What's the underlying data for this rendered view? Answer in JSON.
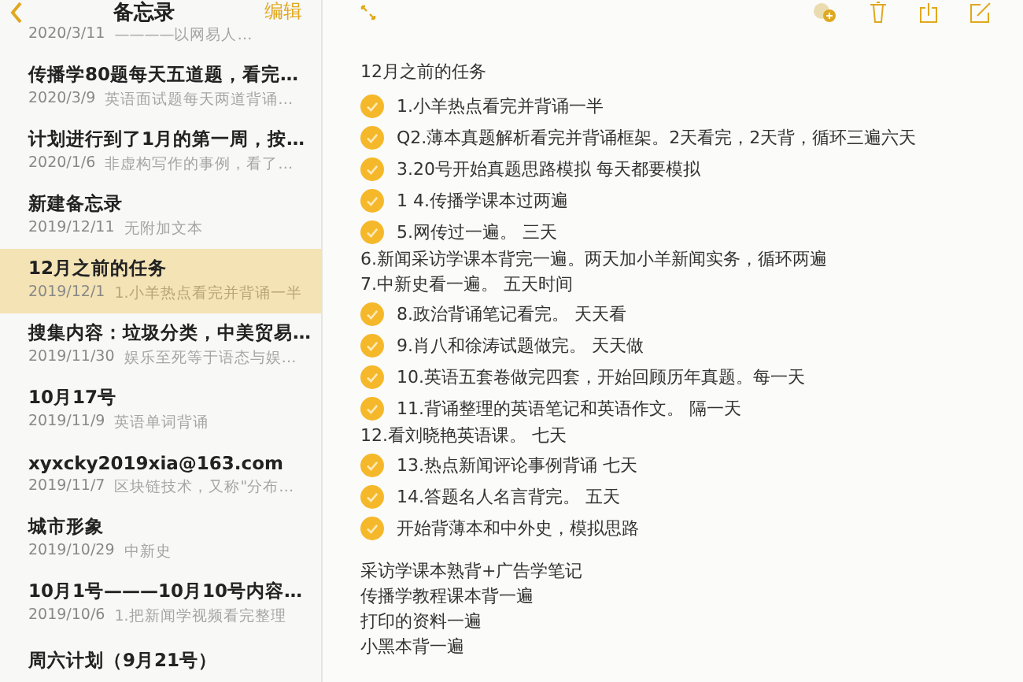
{
  "sidebar": {
    "title": "备忘录",
    "edit": "编辑",
    "notes": [
      {
        "date": "2020/3/11",
        "preview": "————以网易人…",
        "selected": false
      },
      {
        "title": "传播学80题每天五道题，看完…",
        "date": "2020/3/9",
        "preview": "英语面试题每天两道背诵…",
        "selected": false
      },
      {
        "title": "计划进行到了1月的第一周，按…",
        "date": "2020/1/6",
        "preview": "非虚构写作的事例，看了…",
        "selected": false
      },
      {
        "title": "新建备忘录",
        "date": "2019/12/11",
        "preview": "无附加文本",
        "selected": false
      },
      {
        "title": "12月之前的任务",
        "date": "2019/12/1",
        "preview": "1.小羊热点看完并背诵一半",
        "selected": true
      },
      {
        "title": "搜集内容：垃圾分类，中美贸易…",
        "date": "2019/11/30",
        "preview": "娱乐至死等于语态与娱…",
        "selected": false
      },
      {
        "title": "10月17号",
        "date": "2019/11/9",
        "preview": "英语单词背诵",
        "selected": false
      },
      {
        "title": "xyxcky2019xia@163.com",
        "date": "2019/11/7",
        "preview": "区块链技术，又称\"分布…",
        "selected": false
      },
      {
        "title": "城市形象",
        "date": "2019/10/29",
        "preview": "中新史",
        "selected": false
      },
      {
        "title": "10月1号———10月10号内容…",
        "date": "2019/10/6",
        "preview": "1.把新闻学视频看完整理",
        "selected": false
      },
      {
        "title": "周六计划（9月21号）",
        "selected": false
      }
    ]
  },
  "note": {
    "title": "12月之前的任务",
    "lines": [
      {
        "kind": "check",
        "text": "1.小羊热点看完并背诵一半",
        "checked": true
      },
      {
        "kind": "check",
        "text": "Q2.薄本真题解析看完并背诵框架。2天看完，2天背，循环三遍六天",
        "checked": true
      },
      {
        "kind": "check",
        "text": "3.20号开始真题思路模拟  每天都要模拟",
        "checked": true
      },
      {
        "kind": "check",
        "text": "1    4.传播学课本过两遍",
        "checked": true
      },
      {
        "kind": "check",
        "text": "5.网传过一遍。   三天",
        "checked": true
      },
      {
        "kind": "text",
        "text": "6.新闻采访学课本背完一遍。两天加小羊新闻实务，循环两遍"
      },
      {
        "kind": "text",
        "text": "7.中新史看一遍。   五天时间"
      },
      {
        "kind": "check",
        "text": "8.政治背诵笔记看完。   天天看",
        "checked": true
      },
      {
        "kind": "check",
        "text": "9.肖八和徐涛试题做完。 天天做",
        "checked": true
      },
      {
        "kind": "check",
        "text": "10.英语五套卷做完四套，开始回顾历年真题。每一天",
        "checked": true
      },
      {
        "kind": "check",
        "text": "11.背诵整理的英语笔记和英语作文。 隔一天",
        "checked": true
      },
      {
        "kind": "text",
        "text": "12.看刘晓艳英语课。 七天"
      },
      {
        "kind": "check",
        "text": "13.热点新闻评论事例背诵   七天",
        "checked": true
      },
      {
        "kind": "check",
        "text": "14.答题名人名言背完。 五天",
        "checked": true
      },
      {
        "kind": "check",
        "text": "开始背薄本和中外史，模拟思路",
        "checked": true
      },
      {
        "kind": "blank"
      },
      {
        "kind": "text",
        "text": "采访学课本熟背+广告学笔记"
      },
      {
        "kind": "text",
        "text": "传播学教程课本背一遍"
      },
      {
        "kind": "text",
        "text": "打印的资料一遍"
      },
      {
        "kind": "text",
        "text": "小黑本背一遍"
      }
    ]
  }
}
